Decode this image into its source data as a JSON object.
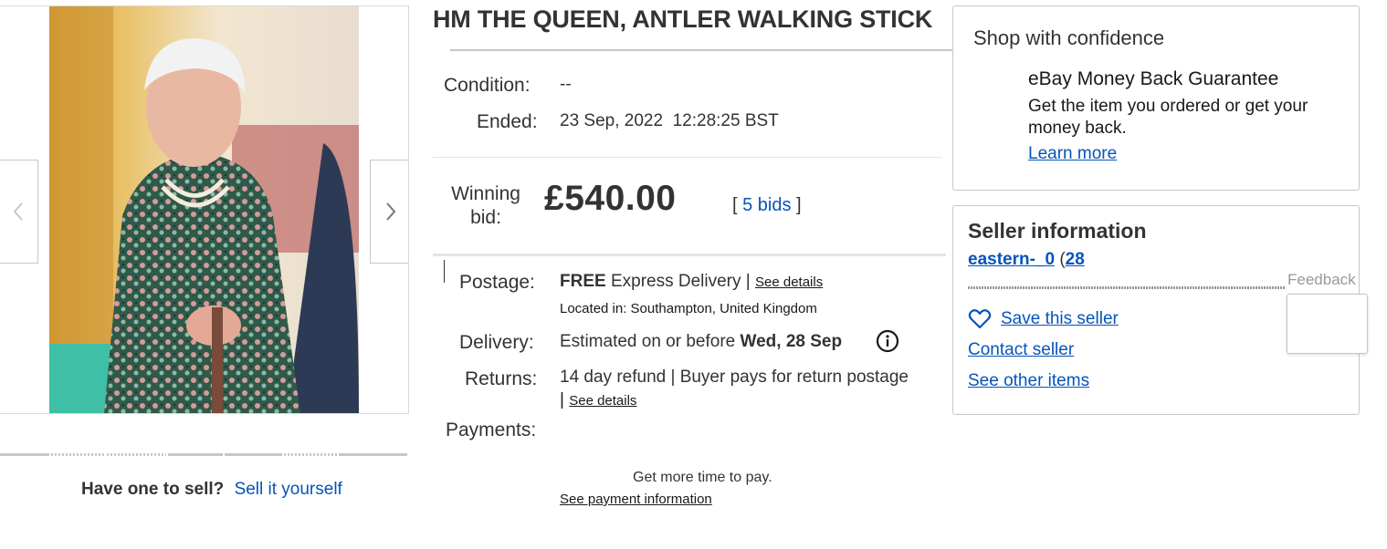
{
  "listing": {
    "title": "HM THE QUEEN, ANTLER WALKING STICK",
    "condition_label": "Condition:",
    "condition_value": "--",
    "ended_label": "Ended:",
    "ended_value": "23 Sep, 2022  12:28:25 BST",
    "winning_label": "Winning bid:",
    "winning_price": "£540.00",
    "bids_open": "[ ",
    "bids_link": "5 bids",
    "bids_close": " ]"
  },
  "postage": {
    "label": "Postage:",
    "free": "FREE",
    "service": " Express Delivery | ",
    "see_details": "See details",
    "located": "Located in: Southampton, United Kingdom"
  },
  "delivery": {
    "label": "Delivery:",
    "prefix": "Estimated on or before ",
    "date": "Wed, 28 Sep",
    "icon": "info-icon"
  },
  "returns": {
    "label": "Returns:",
    "value": "14 day refund | Buyer pays for return postage",
    "pipe": "| ",
    "see_details": "See details"
  },
  "payments": {
    "label": "Payments:",
    "more_time": "Get more time to pay.",
    "see_info": "See payment information"
  },
  "gallery": {
    "prev_icon": "chevron-left-icon",
    "next_icon": "chevron-right-icon",
    "photo_alt": "Photo of HM The Queen holding an antler walking stick"
  },
  "sell": {
    "question": "Have one to sell?",
    "link": "Sell it yourself"
  },
  "confidence": {
    "title": "Shop with confidence",
    "guarantee_title": "eBay Money Back Guarantee",
    "guarantee_desc": "Get the item you ordered or get your money back.",
    "learn_more": "Learn more"
  },
  "seller": {
    "title": "Seller information",
    "name": "eastern-_0",
    "paren": "(",
    "feedback_count": "28",
    "save": "Save this seller",
    "contact": "Contact seller",
    "other_items": "See other items",
    "feedback_tab": "Feedback"
  },
  "colors": {
    "link": "#0654ba",
    "text": "#333333",
    "border": "#c7c7c7"
  }
}
